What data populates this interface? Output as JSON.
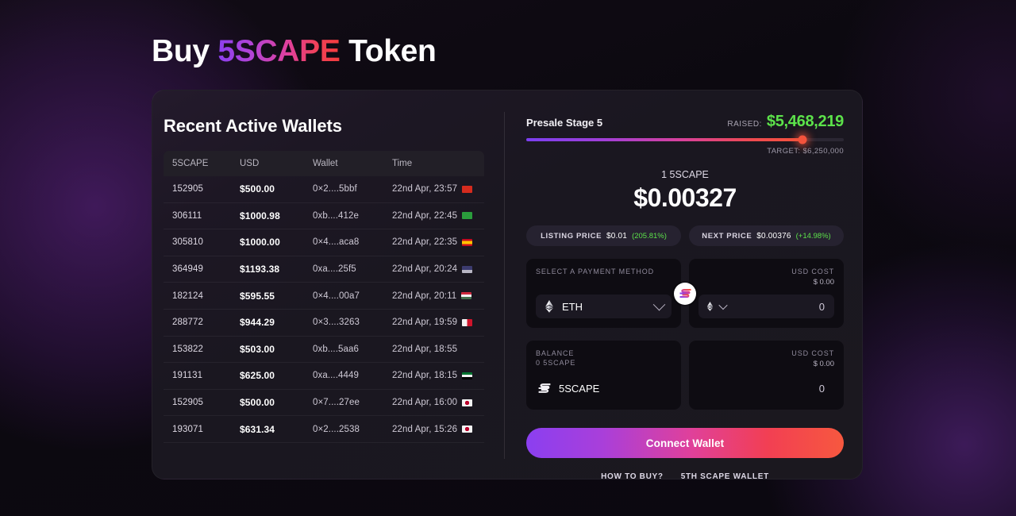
{
  "page": {
    "title_prefix": "Buy ",
    "title_brand": "5SCAPE",
    "title_suffix": " Token"
  },
  "colors": {
    "accent_purple": "#8b3ff0",
    "accent_pink": "#e0409a",
    "accent_red": "#f4533c",
    "success_green": "#5ce24a",
    "card_bg": "#1d1724",
    "page_bg": "#0d0a10"
  },
  "wallets_panel": {
    "heading": "Recent Active Wallets",
    "columns": [
      "5SCAPE",
      "USD",
      "Wallet",
      "Time"
    ],
    "rows": [
      {
        "amount": "152905",
        "usd": "$500.00",
        "wallet": "0×2....5bbf",
        "time": "22nd Apr, 23:57",
        "flag": "CH"
      },
      {
        "amount": "306111",
        "usd": "$1000.98",
        "wallet": "0xb....412e",
        "time": "22nd Apr, 22:45",
        "flag": "BR"
      },
      {
        "amount": "305810",
        "usd": "$1000.00",
        "wallet": "0×4....aca8",
        "time": "22nd Apr, 22:35",
        "flag": "ES"
      },
      {
        "amount": "364949",
        "usd": "$1193.38",
        "wallet": "0xa....25f5",
        "time": "22nd Apr, 20:24",
        "flag": "US"
      },
      {
        "amount": "182124",
        "usd": "$595.55",
        "wallet": "0×4....00a7",
        "time": "22nd Apr, 20:11",
        "flag": "HU"
      },
      {
        "amount": "288772",
        "usd": "$944.29",
        "wallet": "0×3....3263",
        "time": "22nd Apr, 19:59",
        "flag": "MT"
      },
      {
        "amount": "153822",
        "usd": "$503.00",
        "wallet": "0xb....5aa6",
        "time": "22nd Apr, 18:55",
        "flag": ""
      },
      {
        "amount": "191131",
        "usd": "$625.00",
        "wallet": "0xa....4449",
        "time": "22nd Apr, 18:15",
        "flag": "AE"
      },
      {
        "amount": "152905",
        "usd": "$500.00",
        "wallet": "0×7....27ee",
        "time": "22nd Apr, 16:00",
        "flag": "JP"
      },
      {
        "amount": "193071",
        "usd": "$631.34",
        "wallet": "0×2....2538",
        "time": "22nd Apr, 15:26",
        "flag": "JP"
      }
    ]
  },
  "presale": {
    "stage_label": "Presale Stage 5",
    "raised_label": "RAISED:",
    "raised_value": "$5,468,219",
    "target_line": "TARGET: $6,250,000",
    "progress_percent": 87,
    "unit_line": "1 5SCAPE",
    "price": "$0.00327",
    "pills": [
      {
        "label": "LISTING PRICE",
        "value": "$0.01",
        "pct": "(205.81%)"
      },
      {
        "label": "NEXT PRICE",
        "value": "$0.00376",
        "pct": "(+14.98%)"
      }
    ],
    "pay_box": {
      "caption": "SELECT A PAYMENT METHOD",
      "selected_token": "ETH",
      "token_icon": "ethereum-icon",
      "chevron_icon": "chevron-down-icon"
    },
    "cost_box_top": {
      "caption": "USD COST",
      "value_usd": "$ 0.00",
      "amount": "0",
      "token_icon": "ethereum-icon",
      "chevron_icon": "chevron-down-icon"
    },
    "balance_box": {
      "caption": "BALANCE",
      "balance": "0 5SCAPE",
      "token": "5SCAPE",
      "token_icon": "5scape-logo-icon"
    },
    "cost_box_bottom": {
      "caption": "USD COST",
      "value_usd": "$ 0.00",
      "amount": "0"
    },
    "swap_button_icon": "swap-5scape-icon",
    "connect_label": "Connect Wallet",
    "footer_links": [
      {
        "label": "HOW TO BUY?"
      },
      {
        "label": "5TH SCAPE WALLET"
      }
    ]
  }
}
